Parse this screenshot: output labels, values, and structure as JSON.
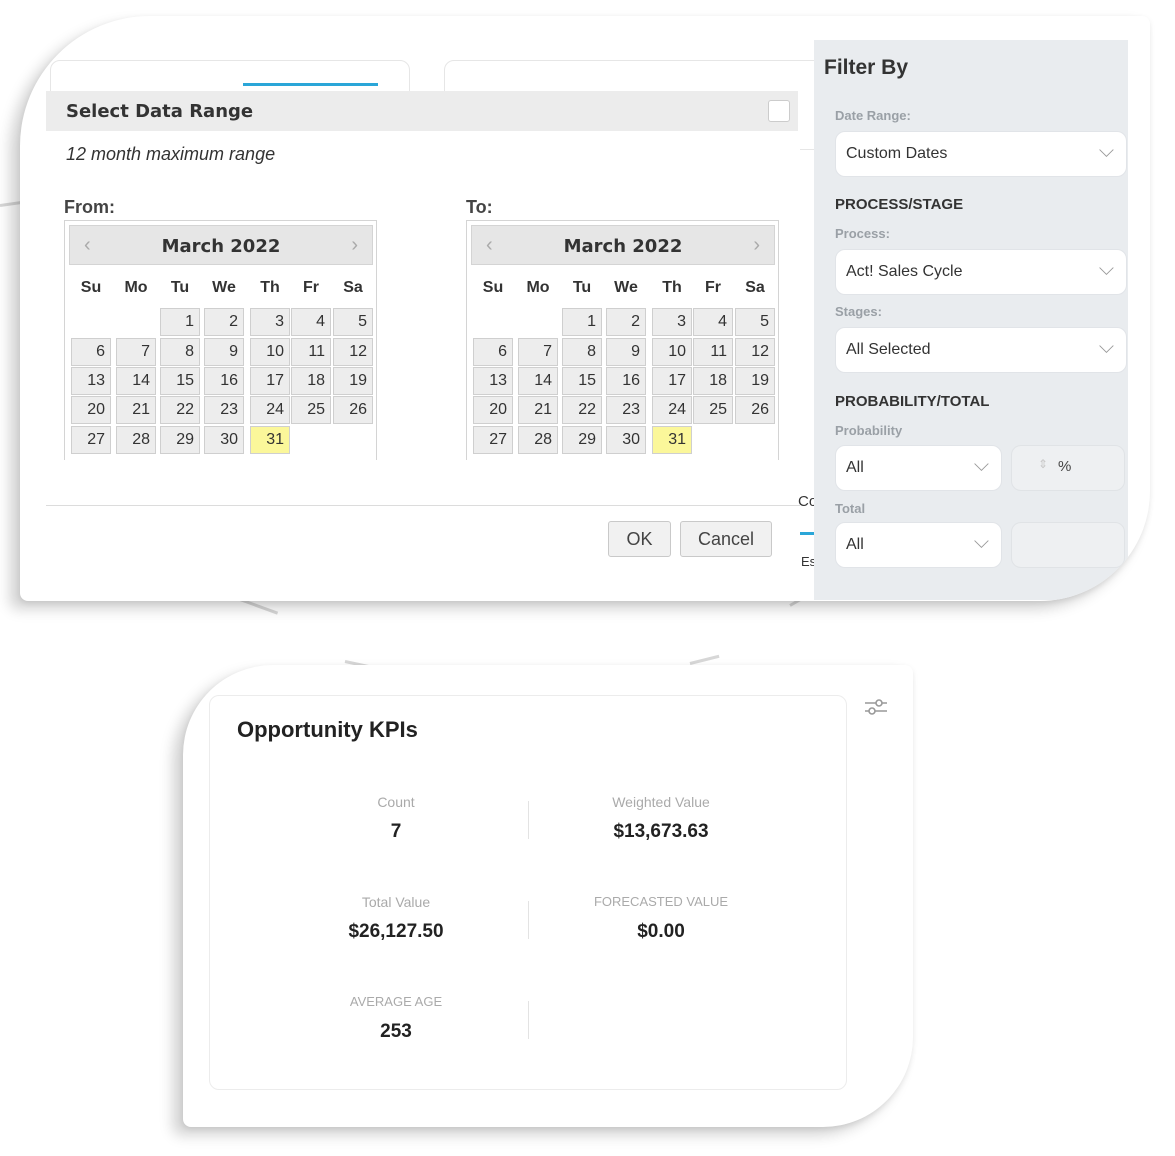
{
  "modal": {
    "title": "Select Data Range",
    "subtitle": "12 month maximum range",
    "from_label": "From:",
    "to_label": "To:",
    "ok_label": "OK",
    "cancel_label": "Cancel"
  },
  "calendar": {
    "month_label": "March 2022",
    "weekdays": [
      "Su",
      "Mo",
      "Tu",
      "We",
      "Th",
      "Fr",
      "Sa"
    ],
    "days": [
      "1",
      "2",
      "3",
      "4",
      "5",
      "6",
      "7",
      "8",
      "9",
      "10",
      "11",
      "12",
      "13",
      "14",
      "15",
      "16",
      "17",
      "18",
      "19",
      "20",
      "21",
      "22",
      "23",
      "24",
      "25",
      "26",
      "27",
      "28",
      "29",
      "30",
      "31"
    ],
    "highlighted_day": "31",
    "prev_icon": "‹",
    "next_icon": "›"
  },
  "fragments": {
    "co": "Co",
    "es": "Es"
  },
  "filter": {
    "title": "Filter By",
    "date_range_label": "Date Range:",
    "date_range_value": "Custom Dates",
    "process_stage_heading": "PROCESS/STAGE",
    "process_label": "Process:",
    "process_value": "Act! Sales Cycle",
    "stages_label": "Stages:",
    "stages_value": "All Selected",
    "prob_total_heading": "PROBABILITY/TOTAL",
    "probability_label": "Probability",
    "probability_value": "All",
    "percent_symbol": "%",
    "total_label": "Total",
    "total_value": "All",
    "chevron_icon": "⌵"
  },
  "kpi": {
    "title": "Opportunity KPIs",
    "count_label": "Count",
    "count_value": "7",
    "weighted_label": "Weighted Value",
    "weighted_value": "$13,673.63",
    "total_label": "Total Value",
    "total_value": "$26,127.50",
    "forecasted_label": "FORECASTED VALUE",
    "forecasted_value": "$0.00",
    "avg_age_label": "AVERAGE AGE",
    "avg_age_value": "253"
  }
}
